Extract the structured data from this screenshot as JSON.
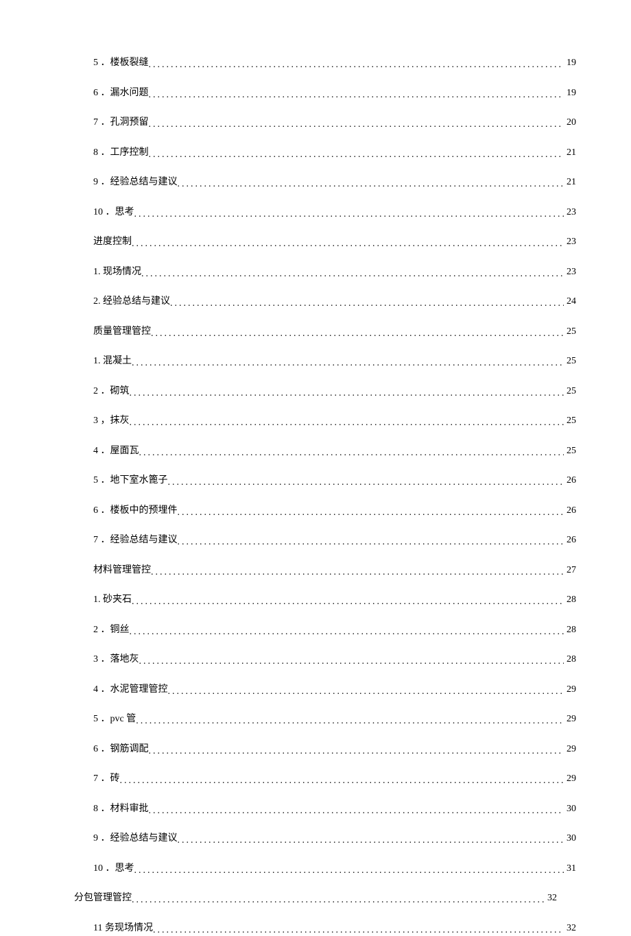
{
  "toc": [
    {
      "indent": 1,
      "label": "5 ．楼板裂缝",
      "page": "19"
    },
    {
      "indent": 1,
      "label": "6 ．漏水问题",
      "page": "19"
    },
    {
      "indent": 1,
      "label": "7 ．孔洞预留",
      "page": "20"
    },
    {
      "indent": 1,
      "label": "8 ．工序控制",
      "page": "21"
    },
    {
      "indent": 1,
      "label": "9 ．经验总结与建议",
      "page": "21"
    },
    {
      "indent": 1,
      "label": "10 ．思考 ",
      "page": "23"
    },
    {
      "indent": 1,
      "label": "进度控制 ",
      "page": "23"
    },
    {
      "indent": 1,
      "label": "1. 现场情况 ",
      "page": "23"
    },
    {
      "indent": 1,
      "label": "2. 经验总结与建议 ",
      "page": "24"
    },
    {
      "indent": 1,
      "label": "质量管理管控 ",
      "page": "25"
    },
    {
      "indent": 1,
      "label": "1. 混凝土 ",
      "page": "25"
    },
    {
      "indent": 1,
      "label": "2 ．砌筑",
      "page": "25"
    },
    {
      "indent": 1,
      "label": "3 ，抹灰",
      "page": "25"
    },
    {
      "indent": 1,
      "label": "4 ．屋面瓦 ",
      "page": "25"
    },
    {
      "indent": 1,
      "label": "5 ．地下室水篦子 ",
      "page": "26"
    },
    {
      "indent": 1,
      "label": "6 ．楼板中的预埋件",
      "page": "26"
    },
    {
      "indent": 1,
      "label": "7 ．经验总结与建议",
      "page": "26"
    },
    {
      "indent": 1,
      "label": "材料管理管控 ",
      "page": "27"
    },
    {
      "indent": 1,
      "label": "1. 砂夹石 ",
      "page": "28"
    },
    {
      "indent": 1,
      "label": "2 ．铜丝",
      "page": "28"
    },
    {
      "indent": 1,
      "label": "3 ．落地灰 ",
      "page": "28"
    },
    {
      "indent": 1,
      "label": "4 ．水泥管理管控 ",
      "page": "29"
    },
    {
      "indent": 1,
      "label": "5 ．pvc 管",
      "page": "29"
    },
    {
      "indent": 1,
      "label": "6 ．钢筋调配",
      "page": "29"
    },
    {
      "indent": 1,
      "label": "7 ．砖",
      "page": "29"
    },
    {
      "indent": 1,
      "label": "8 ．材料审批",
      "page": "30"
    },
    {
      "indent": 1,
      "label": "9 ．经验总结与建议",
      "page": "30"
    },
    {
      "indent": 1,
      "label": "10 ．思考 ",
      "page": "31"
    },
    {
      "indent": 0,
      "label": "分包管理管控 ",
      "page": "32"
    },
    {
      "indent": 1,
      "label": "11   务现场情况 ",
      "page": "32"
    }
  ]
}
